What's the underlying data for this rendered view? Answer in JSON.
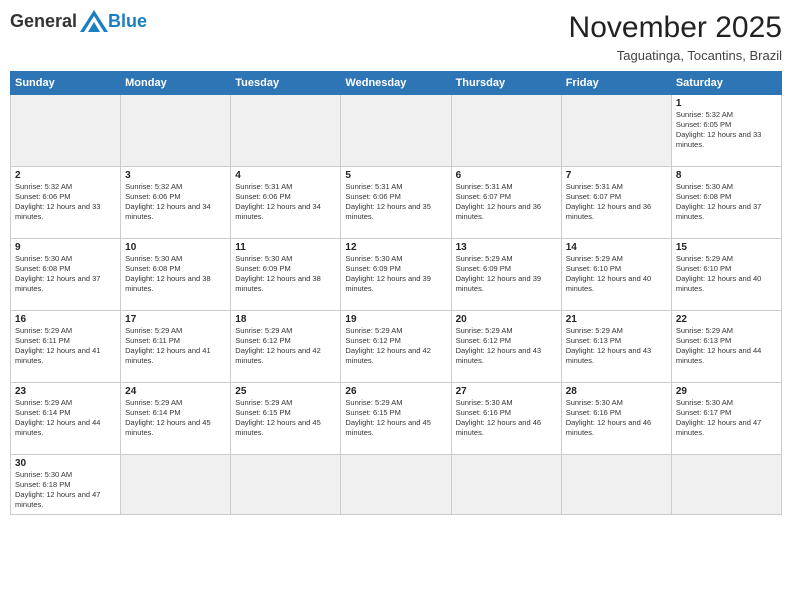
{
  "logo": {
    "general": "General",
    "blue": "Blue"
  },
  "header": {
    "month": "November 2025",
    "location": "Taguatinga, Tocantins, Brazil"
  },
  "weekdays": [
    "Sunday",
    "Monday",
    "Tuesday",
    "Wednesday",
    "Thursday",
    "Friday",
    "Saturday"
  ],
  "weeks": [
    [
      {
        "day": "",
        "empty": true
      },
      {
        "day": "",
        "empty": true
      },
      {
        "day": "",
        "empty": true
      },
      {
        "day": "",
        "empty": true
      },
      {
        "day": "",
        "empty": true
      },
      {
        "day": "",
        "empty": true
      },
      {
        "day": "1",
        "sunrise": "5:32 AM",
        "sunset": "6:05 PM",
        "daylight": "12 hours and 33 minutes."
      }
    ],
    [
      {
        "day": "2",
        "sunrise": "5:32 AM",
        "sunset": "6:06 PM",
        "daylight": "12 hours and 33 minutes."
      },
      {
        "day": "3",
        "sunrise": "5:32 AM",
        "sunset": "6:06 PM",
        "daylight": "12 hours and 34 minutes."
      },
      {
        "day": "4",
        "sunrise": "5:31 AM",
        "sunset": "6:06 PM",
        "daylight": "12 hours and 34 minutes."
      },
      {
        "day": "5",
        "sunrise": "5:31 AM",
        "sunset": "6:06 PM",
        "daylight": "12 hours and 35 minutes."
      },
      {
        "day": "6",
        "sunrise": "5:31 AM",
        "sunset": "6:07 PM",
        "daylight": "12 hours and 36 minutes."
      },
      {
        "day": "7",
        "sunrise": "5:31 AM",
        "sunset": "6:07 PM",
        "daylight": "12 hours and 36 minutes."
      },
      {
        "day": "8",
        "sunrise": "5:30 AM",
        "sunset": "6:08 PM",
        "daylight": "12 hours and 37 minutes."
      }
    ],
    [
      {
        "day": "9",
        "sunrise": "5:30 AM",
        "sunset": "6:08 PM",
        "daylight": "12 hours and 37 minutes."
      },
      {
        "day": "10",
        "sunrise": "5:30 AM",
        "sunset": "6:08 PM",
        "daylight": "12 hours and 38 minutes."
      },
      {
        "day": "11",
        "sunrise": "5:30 AM",
        "sunset": "6:09 PM",
        "daylight": "12 hours and 38 minutes."
      },
      {
        "day": "12",
        "sunrise": "5:30 AM",
        "sunset": "6:09 PM",
        "daylight": "12 hours and 39 minutes."
      },
      {
        "day": "13",
        "sunrise": "5:29 AM",
        "sunset": "6:09 PM",
        "daylight": "12 hours and 39 minutes."
      },
      {
        "day": "14",
        "sunrise": "5:29 AM",
        "sunset": "6:10 PM",
        "daylight": "12 hours and 40 minutes."
      },
      {
        "day": "15",
        "sunrise": "5:29 AM",
        "sunset": "6:10 PM",
        "daylight": "12 hours and 40 minutes."
      }
    ],
    [
      {
        "day": "16",
        "sunrise": "5:29 AM",
        "sunset": "6:11 PM",
        "daylight": "12 hours and 41 minutes."
      },
      {
        "day": "17",
        "sunrise": "5:29 AM",
        "sunset": "6:11 PM",
        "daylight": "12 hours and 41 minutes."
      },
      {
        "day": "18",
        "sunrise": "5:29 AM",
        "sunset": "6:12 PM",
        "daylight": "12 hours and 42 minutes."
      },
      {
        "day": "19",
        "sunrise": "5:29 AM",
        "sunset": "6:12 PM",
        "daylight": "12 hours and 42 minutes."
      },
      {
        "day": "20",
        "sunrise": "5:29 AM",
        "sunset": "6:12 PM",
        "daylight": "12 hours and 43 minutes."
      },
      {
        "day": "21",
        "sunrise": "5:29 AM",
        "sunset": "6:13 PM",
        "daylight": "12 hours and 43 minutes."
      },
      {
        "day": "22",
        "sunrise": "5:29 AM",
        "sunset": "6:13 PM",
        "daylight": "12 hours and 44 minutes."
      }
    ],
    [
      {
        "day": "23",
        "sunrise": "5:29 AM",
        "sunset": "6:14 PM",
        "daylight": "12 hours and 44 minutes."
      },
      {
        "day": "24",
        "sunrise": "5:29 AM",
        "sunset": "6:14 PM",
        "daylight": "12 hours and 45 minutes."
      },
      {
        "day": "25",
        "sunrise": "5:29 AM",
        "sunset": "6:15 PM",
        "daylight": "12 hours and 45 minutes."
      },
      {
        "day": "26",
        "sunrise": "5:29 AM",
        "sunset": "6:15 PM",
        "daylight": "12 hours and 45 minutes."
      },
      {
        "day": "27",
        "sunrise": "5:30 AM",
        "sunset": "6:16 PM",
        "daylight": "12 hours and 46 minutes."
      },
      {
        "day": "28",
        "sunrise": "5:30 AM",
        "sunset": "6:16 PM",
        "daylight": "12 hours and 46 minutes."
      },
      {
        "day": "29",
        "sunrise": "5:30 AM",
        "sunset": "6:17 PM",
        "daylight": "12 hours and 47 minutes."
      }
    ],
    [
      {
        "day": "30",
        "sunrise": "5:30 AM",
        "sunset": "6:18 PM",
        "daylight": "12 hours and 47 minutes."
      },
      {
        "day": "",
        "empty": true
      },
      {
        "day": "",
        "empty": true
      },
      {
        "day": "",
        "empty": true
      },
      {
        "day": "",
        "empty": true
      },
      {
        "day": "",
        "empty": true
      },
      {
        "day": "",
        "empty": true
      }
    ]
  ]
}
